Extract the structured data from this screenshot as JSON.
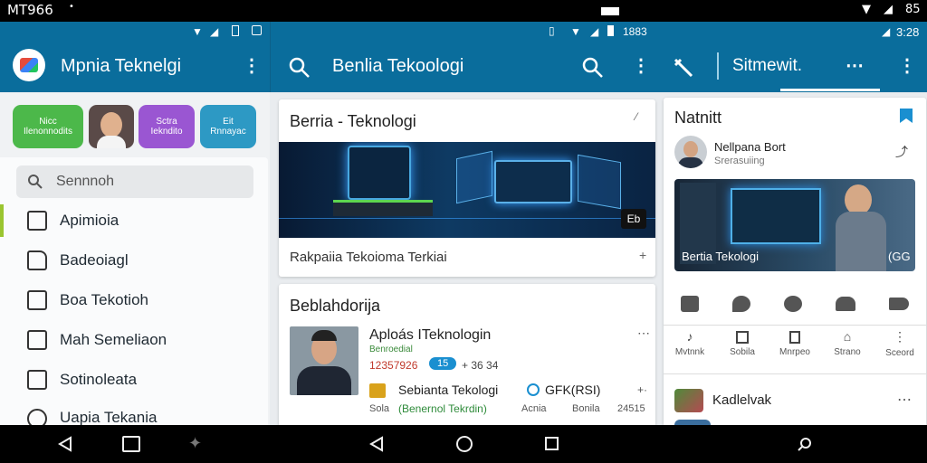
{
  "status_bar": {
    "carrier": "MT966",
    "right_text": "85",
    "time_mid": "1883",
    "time_right": "3:28"
  },
  "left_panel": {
    "title": "Mpnia Teknelgi",
    "chips": [
      {
        "line1": "Nicc",
        "line2": "Ilenonnodits",
        "color": "#4cb84a"
      },
      {
        "line1": "Sctra",
        "line2": "Iekndito",
        "color": "#9a56d2"
      },
      {
        "line1": "Eit",
        "line2": "Rnnayac",
        "color": "#2d99c4"
      }
    ],
    "search_placeholder": "Sennnoh",
    "menu": [
      {
        "label": "Apimioia",
        "icon": "grid-icon"
      },
      {
        "label": "Badeoiagl",
        "icon": "tag-icon"
      },
      {
        "label": "Boa Tekotioh",
        "icon": "home-icon"
      },
      {
        "label": "Mah Semeliaon",
        "icon": "square-icon"
      },
      {
        "label": "Sotinoleata",
        "icon": "lock-icon"
      },
      {
        "label": "Uapia Tekania",
        "icon": "gear-icon"
      }
    ]
  },
  "center_panel": {
    "title": "Benlia Tekoologi",
    "featured_card": {
      "title": "Berria - Teknologi",
      "caption": "Rakpaiia Tekoioma Terkiai",
      "badge": "Eb"
    },
    "second_card": {
      "heading": "Beblahdorija",
      "article": {
        "title": "Aploás ITeknologin",
        "sub": "Benroedial",
        "number": "12357926",
        "pill": "15",
        "extra": "+ 36 34"
      },
      "row": {
        "label": "Sebianta Tekologi",
        "code": "GFK(RSI)",
        "meta_left": "Sola",
        "green": "(Benernol Tekrdin)",
        "meta_a": "Acnia",
        "meta_b": "Bonila",
        "meta_num": "24515"
      }
    }
  },
  "right_panel": {
    "title": "Sitmewit.",
    "card_title": "Natnitt",
    "author": {
      "name": "Nellpana Bort",
      "sub": "Srerasuiing"
    },
    "image_caption": "Bertia Tekologi",
    "image_tag": "(GG",
    "actions": [
      "Mvtnnk",
      "Sobila",
      "Mnrpeo",
      "Strano",
      "Sceord"
    ],
    "footer_name": "Kadlelvak"
  }
}
